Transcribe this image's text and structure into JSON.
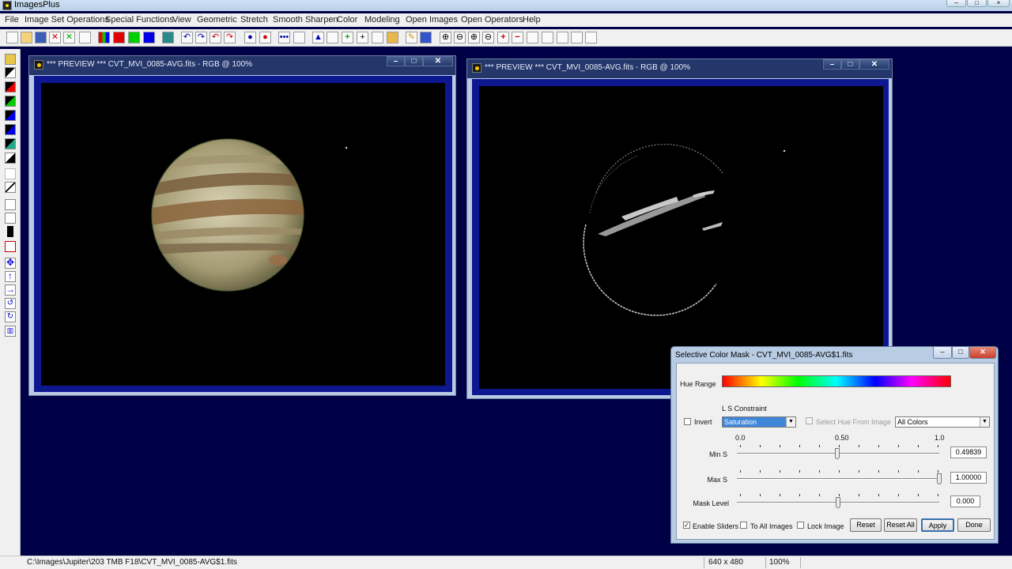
{
  "app": {
    "title": "ImagesPlus"
  },
  "menu": [
    "File",
    "Image Set Operations",
    "Special Functions",
    "View",
    "Geometric",
    "Stretch",
    "Smooth Sharpen",
    "Color",
    "Modeling",
    "Open Images",
    "Open Operators",
    "Help"
  ],
  "windows": [
    {
      "title": "*** PREVIEW *** CVT_MVI_0085-AVG.fits - RGB @ 100%"
    },
    {
      "title": "*** PREVIEW *** CVT_MVI_0085-AVG.fits - RGB @ 100%"
    }
  ],
  "dialog": {
    "title": "Selective Color Mask - CVT_MVI_0085-AVG$1.fits",
    "hue_range_label": "Hue Range",
    "ls_constraint_label": "L S Constraint",
    "invert_label": "Invert",
    "constraint_value": "Saturation",
    "select_hue_label": "Select Hue From Image",
    "color_value": "All Colors",
    "scale": [
      "0.0",
      "0.50",
      "1.0"
    ],
    "sliders": [
      {
        "label": "Min S",
        "value": "0.49839",
        "position": 0.498
      },
      {
        "label": "Max S",
        "value": "1.00000",
        "position": 1.0
      },
      {
        "label": "Mask Level",
        "value": "0.000",
        "position": 0.5
      }
    ],
    "enable_sliders_label": "Enable Sliders",
    "enable_sliders_checked": true,
    "to_all_images_label": "To All Images",
    "lock_image_label": "Lock Image",
    "buttons": {
      "reset": "Reset",
      "reset_all": "Reset All",
      "apply": "Apply",
      "done": "Done"
    }
  },
  "status": {
    "path": "C:\\Images\\Jupiter\\203 TMB F18\\CVT_MVI_0085-AVG$1.fits",
    "size": "640 x 480",
    "zoom": "100%"
  },
  "colors": {
    "desktop": "#000046",
    "canvas_border": "#0d1890",
    "window_frame": "#b9cbe3"
  }
}
